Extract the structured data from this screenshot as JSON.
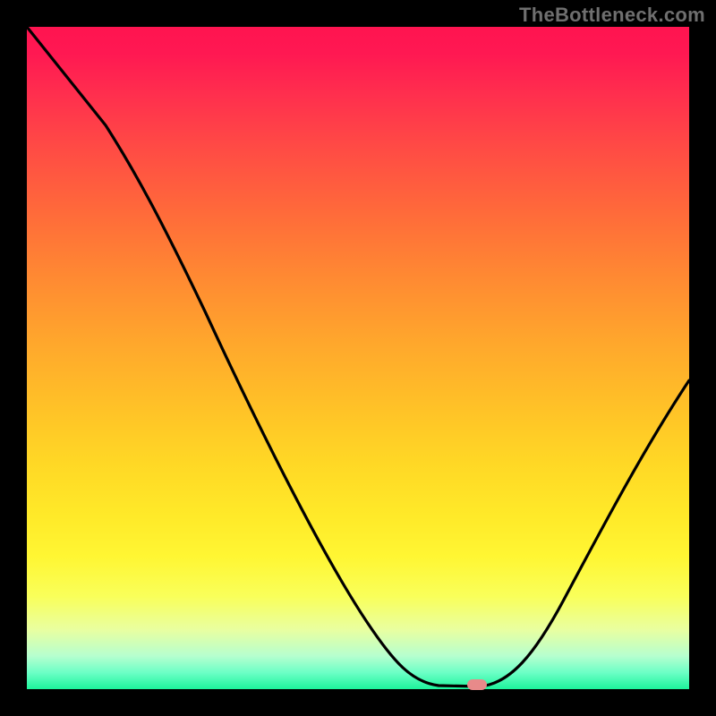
{
  "watermark": "TheBottleneck.com",
  "chart_data": {
    "type": "line",
    "title": "",
    "xlabel": "",
    "ylabel": "",
    "xlim": [
      0,
      100
    ],
    "ylim": [
      0,
      100
    ],
    "x": [
      0,
      12,
      22,
      32,
      42,
      52,
      58,
      63,
      66,
      70,
      75,
      82,
      90,
      100
    ],
    "values": [
      100,
      85,
      73,
      58,
      40,
      20,
      8,
      1,
      0,
      0,
      6,
      18,
      34,
      55
    ],
    "marker": {
      "x": 68,
      "y": 0
    },
    "gradient": [
      "#ff1450",
      "#ffea29",
      "#1df49b"
    ]
  }
}
